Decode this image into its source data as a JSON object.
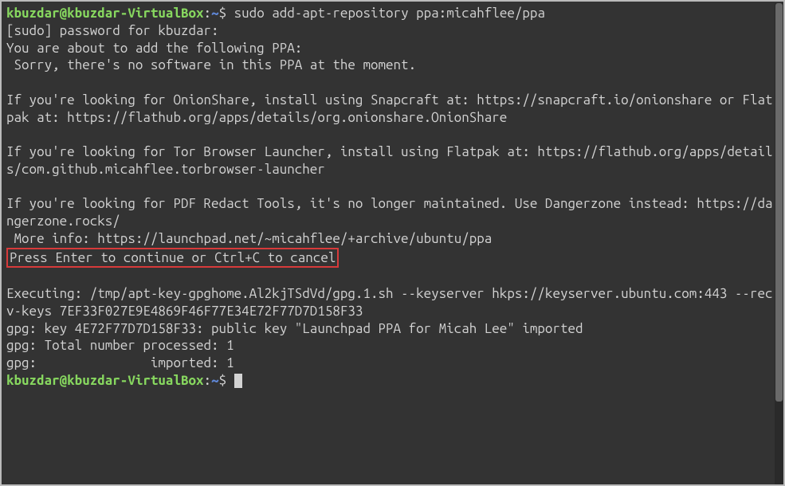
{
  "prompt1": {
    "userhost": "kbuzdar@kbuzdar-VirtualBox",
    "sep": ":",
    "path": "~",
    "dollar": "$",
    "command": " sudo add-apt-repository ppa:micahflee/ppa"
  },
  "lines": {
    "l2": "[sudo] password for kbuzdar:",
    "l3": "You are about to add the following PPA:",
    "l4": " Sorry, there's no software in this PPA at the moment.",
    "l5": "",
    "l6": "If you're looking for OnionShare, install using Snapcraft at: https://snapcraft.io/onionshare or Flatpak at: https://flathub.org/apps/details/org.onionshare.OnionShare",
    "l7": "",
    "l8": "If you're looking for Tor Browser Launcher, install using Flatpak at: https://flathub.org/apps/details/com.github.micahflee.torbrowser-launcher",
    "l9": "",
    "l10": "If you're looking for PDF Redact Tools, it's no longer maintained. Use Dangerzone instead: https://dangerzone.rocks/",
    "l11": " More info: https://launchpad.net/~micahflee/+archive/ubuntu/ppa",
    "l12": "Press Enter to continue or Ctrl+C to cancel",
    "l13": "",
    "l14": "Executing: /tmp/apt-key-gpghome.Al2kjTSdVd/gpg.1.sh --keyserver hkps://keyserver.ubuntu.com:443 --recv-keys 7EF33F027E9E4869F46F77E34E72F77D7D158F33",
    "l15": "gpg: key 4E72F77D7D158F33: public key \"Launchpad PPA for Micah Lee\" imported",
    "l16": "gpg: Total number processed: 1",
    "l17": "gpg:               imported: 1"
  },
  "prompt2": {
    "userhost": "kbuzdar@kbuzdar-VirtualBox",
    "sep": ":",
    "path": "~",
    "dollar": "$",
    "command": " "
  }
}
